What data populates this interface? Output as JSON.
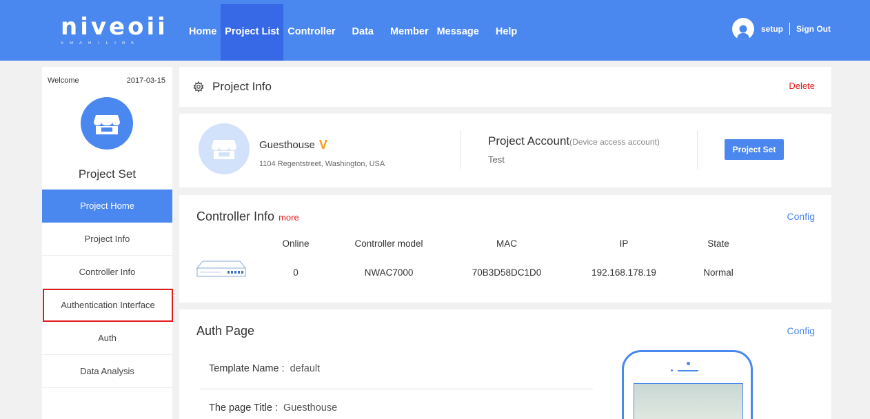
{
  "header": {
    "logo_text": "niveoii",
    "logo_subtext": "SMARTLINK",
    "nav": [
      {
        "label": "Home"
      },
      {
        "label": "Project List"
      },
      {
        "label": "Controller"
      },
      {
        "label": "Data"
      },
      {
        "label": "Member"
      },
      {
        "label": "Message"
      },
      {
        "label": "Help"
      }
    ],
    "active_nav": "Project List",
    "username": "setup",
    "sign_out": "Sign Out"
  },
  "sidebar": {
    "welcome": "Welcome",
    "date": "2017-03-15",
    "title": "Project Set",
    "items": [
      {
        "label": "Project Home"
      },
      {
        "label": "Project Info"
      },
      {
        "label": "Controller Info"
      },
      {
        "label": "Authentication Interface"
      },
      {
        "label": "Auth"
      },
      {
        "label": "Data Analysis"
      }
    ],
    "active_item": "Project Home",
    "highlighted_item": "Authentication Interface"
  },
  "project_info": {
    "title": "Project Info",
    "delete_label": "Delete"
  },
  "project_card": {
    "name": "Guesthouse",
    "badge": "V",
    "address": "1104 Regentstreet, Washington, USA",
    "account_title": "Project Account",
    "account_subtitle": "(Device access account)",
    "account_value": "Test",
    "project_set_button": "Project Set"
  },
  "controller_info": {
    "title": "Controller Info",
    "more_label": "more",
    "config_label": "Config",
    "columns": [
      "Online",
      "Controller model",
      "MAC",
      "IP",
      "State"
    ],
    "row": [
      "0",
      "NWAC7000",
      "70B3D58DC1D0",
      "192.168.178.19",
      "Normal"
    ]
  },
  "auth_page": {
    "title": "Auth Page",
    "config_label": "Config",
    "template_label": "Template Name :",
    "template_value": "default",
    "page_title_label": "The page Title :",
    "page_title_value": "Guesthouse"
  },
  "colors": {
    "primary": "#4a87ef",
    "nav_active": "#3768e6",
    "danger": "#e31a1a",
    "badge": "#f39c12"
  }
}
